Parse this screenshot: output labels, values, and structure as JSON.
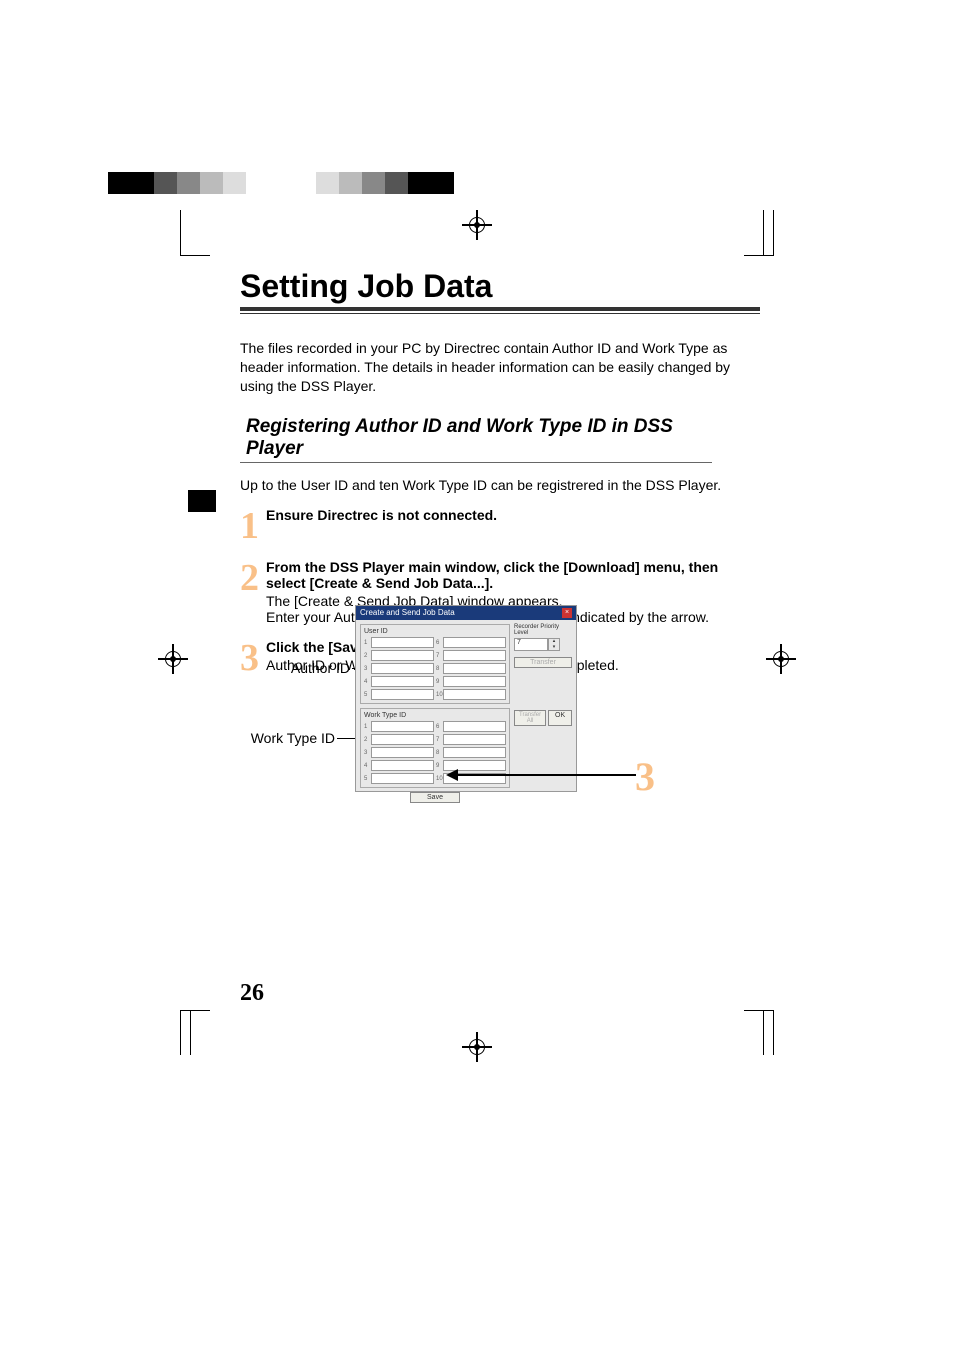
{
  "page": {
    "title": "Setting Job Data",
    "intro": "The files recorded in your PC by Directrec contain Author ID and Work Type as header information. The details in header information can be easily changed by using the DSS Player.",
    "subtitle": "Registering Author ID and Work Type ID in DSS Player",
    "subdesc": "Up to the User ID and ten Work Type ID can be registrered in the DSS Player.",
    "number": "26"
  },
  "steps": [
    {
      "num": "1",
      "bold": "Ensure Directrec is not connected.",
      "plain": ""
    },
    {
      "num": "2",
      "bold": "From the DSS Player main window, click the [Download] menu, then select [Create & Send Job Data...].",
      "plain": "The [Create & Send Job Data] window appears.\nEnter your Author ID or Work Type ID in the field indicated by the arrow."
    },
    {
      "num": "3",
      "bold": "Click the [Save] button.",
      "plain": "Author ID or Work Type ID registration is now completed."
    }
  ],
  "labels": {
    "author": "Author ID",
    "work": "Work Type ID"
  },
  "dialog": {
    "title": "Create and Send Job Data",
    "user_id_group": "User ID",
    "work_type_group": "Work Type ID",
    "priority_label": "Recorder Priority Level",
    "priority_value": "7",
    "transfer": "Transfer",
    "transfer_all": "Transfer All",
    "ok": "OK",
    "save": "Save"
  },
  "callout_num": "3"
}
